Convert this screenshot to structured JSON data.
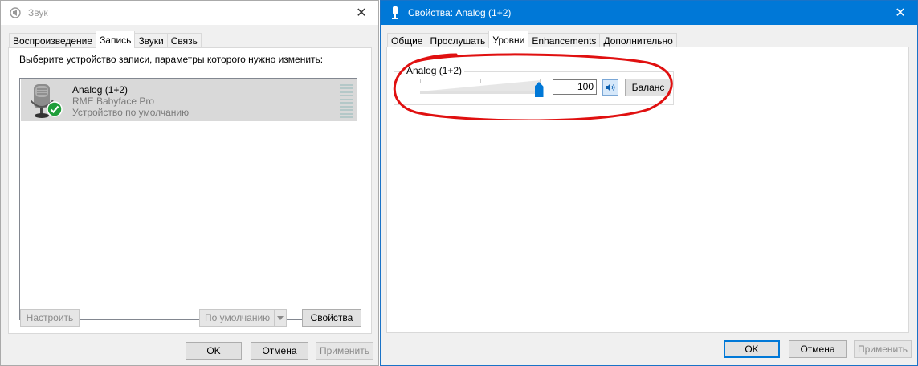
{
  "sound_window": {
    "title": "Звук",
    "close_glyph": "✕",
    "tabs": [
      {
        "label": "Воспроизведение",
        "active": false
      },
      {
        "label": "Запись",
        "active": true
      },
      {
        "label": "Звуки",
        "active": false
      },
      {
        "label": "Связь",
        "active": false
      }
    ],
    "instruction": "Выберите устройство записи, параметры которого нужно изменить:",
    "device": {
      "name": "Analog (1+2)",
      "driver": "RME Babyface Pro",
      "status": "Устройство по умолчанию",
      "icon": "microphone-icon",
      "badge_icon": "default-check-icon"
    },
    "buttons": {
      "configure": "Настроить",
      "set_default": "По умолчанию",
      "properties": "Свойства",
      "ok": "OK",
      "cancel": "Отмена",
      "apply": "Применить"
    }
  },
  "props_window": {
    "title": "Свойства: Analog (1+2)",
    "close_glyph": "✕",
    "tabs": [
      {
        "label": "Общие",
        "active": false
      },
      {
        "label": "Прослушать",
        "active": false
      },
      {
        "label": "Уровни",
        "active": true
      },
      {
        "label": "Enhancements",
        "active": false
      },
      {
        "label": "Дополнительно",
        "active": false
      }
    ],
    "levels": {
      "group_label": "Analog (1+2)",
      "value": "100",
      "slider_fraction": 1.0,
      "balance_button": "Баланс",
      "mute_icon": "speaker-icon"
    },
    "buttons": {
      "ok": "OK",
      "cancel": "Отмена",
      "apply": "Применить"
    }
  },
  "colors": {
    "accent": "#0078d7",
    "highlight": "#e01010",
    "check": "#1f9e3a"
  }
}
